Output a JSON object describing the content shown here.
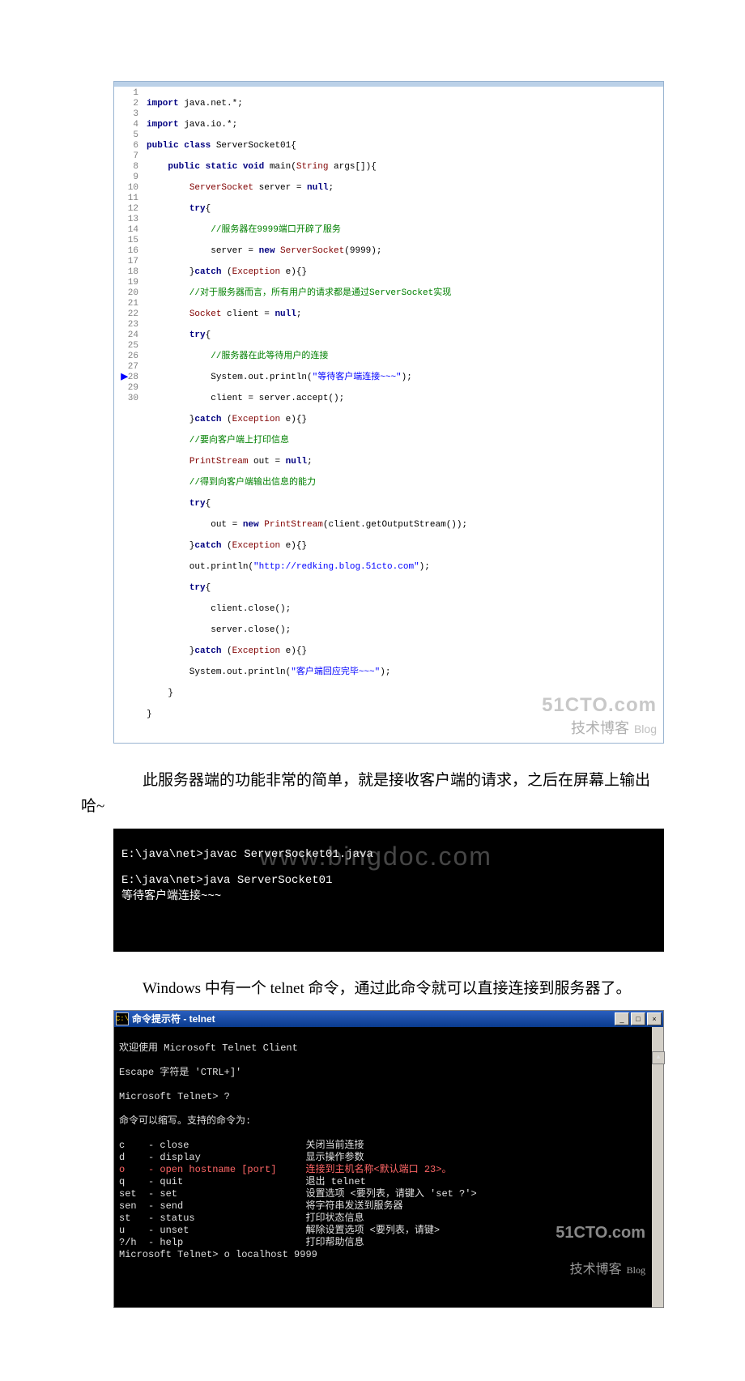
{
  "code": {
    "line_count": 30,
    "l1": {
      "kw": "import",
      "rest": " java.net.*;"
    },
    "l2": {
      "kw": "import",
      "rest": " java.io.*;"
    },
    "l3": {
      "a": "public class ",
      "cls": "ServerSocket01",
      "b": "{"
    },
    "l4": {
      "a": "    ",
      "kw1": "public static void",
      "b": " main(",
      "cls": "String",
      "c": " args[]){"
    },
    "l5": {
      "a": "        ",
      "cls": "ServerSocket",
      "b": " server = ",
      "kw": "null",
      "c": ";"
    },
    "l6": {
      "a": "        ",
      "kw": "try",
      "b": "{"
    },
    "l7": "            //服务器在9999端口开辟了服务",
    "l8": {
      "a": "            server = ",
      "kw": "new",
      "b": " ",
      "cls": "ServerSocket",
      "c": "(9999);"
    },
    "l9": {
      "a": "        }",
      "kw": "catch",
      "b": " (",
      "cls": "Exception",
      "c": " e){}"
    },
    "l10": "        //对于服务器而言，所有用户的请求都是通过ServerSocket实现",
    "l11": {
      "a": "        ",
      "cls": "Socket",
      "b": " client = ",
      "kw": "null",
      "c": ";"
    },
    "l12": {
      "a": "        ",
      "kw": "try",
      "b": "{"
    },
    "l13": "            //服务器在此等待用户的连接",
    "l14": {
      "a": "            System.out.println(",
      "str": "\"等待客户端连接~~~\"",
      "b": ");"
    },
    "l15": "            client = server.accept();",
    "l16": {
      "a": "        }",
      "kw": "catch",
      "b": " (",
      "cls": "Exception",
      "c": " e){}"
    },
    "l17": "        //要向客户端上打印信息",
    "l18": {
      "a": "        ",
      "cls": "PrintStream",
      "b": " out = ",
      "kw": "null",
      "c": ";"
    },
    "l19": "        //得到向客户端输出信息的能力",
    "l20": {
      "a": "        ",
      "kw": "try",
      "b": "{"
    },
    "l21": {
      "a": "            out = ",
      "kw": "new",
      "b": " ",
      "cls": "PrintStream",
      "c": "(client.getOutputStream());"
    },
    "l22": {
      "a": "        }",
      "kw": "catch",
      "b": " (",
      "cls": "Exception",
      "c": " e){}"
    },
    "l23": {
      "a": "        out.println(",
      "str": "\"http://redking.blog.51cto.com\"",
      "b": ");"
    },
    "l24": {
      "a": "        ",
      "kw": "try",
      "b": "{"
    },
    "l25": "            client.close();",
    "l26": "            server.close();",
    "l27": {
      "a": "        }",
      "kw": "catch",
      "b": " (",
      "cls": "Exception",
      "c": " e){}"
    },
    "l28": {
      "a": "        System.out.println(",
      "str": "\"客户端回应完毕~~~\"",
      "b": ");"
    },
    "l29": "    }",
    "l30": "}"
  },
  "text1": "　　此服务器端的功能非常的简单，就是接收客户端的请求，之后在屏幕上输出哈~",
  "terminal1": {
    "l1": "E:\\java\\net>javac ServerSocket01.java",
    "l2": "",
    "l3": "E:\\java\\net>java ServerSocket01",
    "l4": "等待客户端连接~~~",
    "watermark": "www.bingdoc.com"
  },
  "text2": "　　Windows 中有一个 telnet 命令，通过此命令就可以直接连接到服务器了。",
  "cmdwin": {
    "title_icon": "C:\\",
    "title": "命令提示符 - telnet",
    "body": {
      "l1": "欢迎使用 Microsoft Telnet Client",
      "l2": "",
      "l3": "Escape 字符是 'CTRL+]'",
      "l4": "",
      "l5": "Microsoft Telnet> ?",
      "l6": "",
      "l7": "命令可以缩写。支持的命令为:",
      "l8": "",
      "l9": "c    - close                    关闭当前连接",
      "l10": "d    - display                  显示操作参数",
      "l11": "o    - open hostname [port]     连接到主机名称<默认端口 23>。",
      "l12": "q    - quit                     退出 telnet",
      "l13": "set  - set                      设置选项 <要列表，请键入 'set ?'>",
      "l14": "sen  - send                     将字符串发送到服务器",
      "l15": "st   - status                   打印状态信息",
      "l16": "u    - unset                    解除设置选项 <要列表，请键>",
      "l17": "?/h  - help                     打印帮助信息",
      "l18": "Microsoft Telnet> o localhost 9999"
    }
  },
  "wm51cto": {
    "top": "51CTO.com",
    "bottom": "技术博客",
    "blog": "Blog"
  }
}
